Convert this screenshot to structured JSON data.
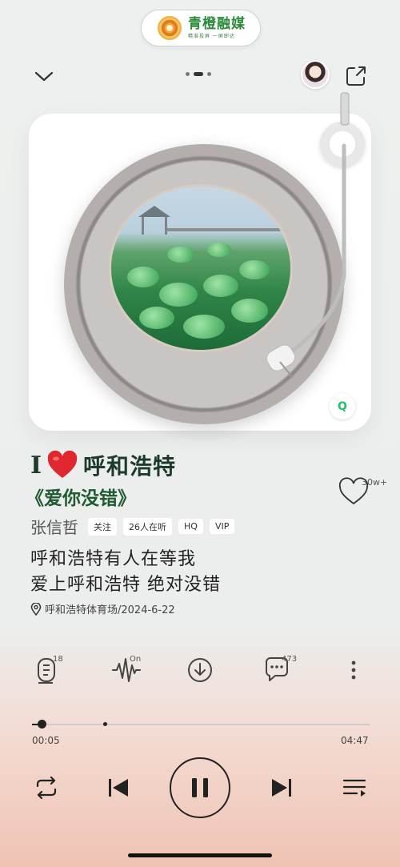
{
  "brand": {
    "name": "青橙融媒",
    "tagline": "精准投屏 一屏即达"
  },
  "header": {
    "pager_dots": 3,
    "active_dot": 1
  },
  "player": {
    "title_prefix": "I",
    "title_city": "呼和浩特",
    "song_title": "《爱你没错》",
    "artist": "张信哲",
    "tags": [
      "关注",
      "26人在听",
      "HQ",
      "VIP"
    ],
    "lyrics": [
      "呼和浩特有人在等我",
      "爱上呼和浩特 绝对没错"
    ],
    "location": "呼和浩特体育场/2024-6-22",
    "like_count": "30w+"
  },
  "actions": {
    "lyrics_count": "18",
    "audio_effect": "On",
    "comments_count": "473"
  },
  "progress": {
    "current": "00:05",
    "total": "04:47",
    "fraction": 0.018,
    "buffered": 0.21
  },
  "colors": {
    "accent_green": "#1d3b2a",
    "heart_red": "#e0262e",
    "brand_green": "#2a8a3a"
  }
}
